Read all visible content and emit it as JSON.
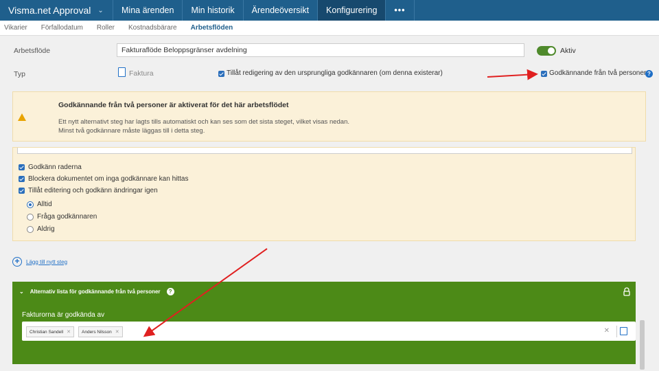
{
  "app": {
    "title": "Visma.net Approval"
  },
  "nav": {
    "items": [
      "Mina ärenden",
      "Min historik",
      "Ärendeöversikt",
      "Konfigurering"
    ],
    "more": "•••"
  },
  "subnav": [
    "Vikarier",
    "Förfallodatum",
    "Roller",
    "Kostnadsbärare",
    "Arbetsflöden"
  ],
  "workflow": {
    "label": "Arbetsflöde",
    "value": "Fakturaflöde Beloppsgränser avdelning",
    "active_label": "Aktiv",
    "type_label": "Typ",
    "type_value": "Faktura",
    "allow_edit_label": "Tillåt redigering av den ursprungliga godkännaren (om denna existerar)",
    "two_person_label": "Godkännande från två personer"
  },
  "warning": {
    "title": "Godkännande från två personer är aktiverat för det här arbetsflödet",
    "line1": "Ett nytt alternativt steg har lagts tills automatiskt och kan ses som det sista steget, vilket visas nedan.",
    "line2": "Minst två godkännare måste läggas till i detta steg."
  },
  "step": {
    "checkboxes": [
      "Godkänn raderna",
      "Blockera dokumentet om inga godkännare kan hittas",
      "Tillåt editering och godkänn ändringar igen"
    ],
    "radios": [
      "Alltid",
      "Fråga godkännaren",
      "Aldrig"
    ],
    "selected_radio": "Alltid"
  },
  "add_step": {
    "label": "Lägg till nytt steg"
  },
  "alt_list": {
    "title": "Alternativ lista för godkännande från två personer",
    "approved_by_label": "Fakturorna är godkända av",
    "approvers": [
      "Christian Sandell",
      "Anders Nilsson"
    ]
  },
  "colors": {
    "nav": "#1f5f8c",
    "accent_green": "#4c8a17",
    "warning_bg": "#fbf1d9",
    "annotation_arrow": "#e02020"
  }
}
